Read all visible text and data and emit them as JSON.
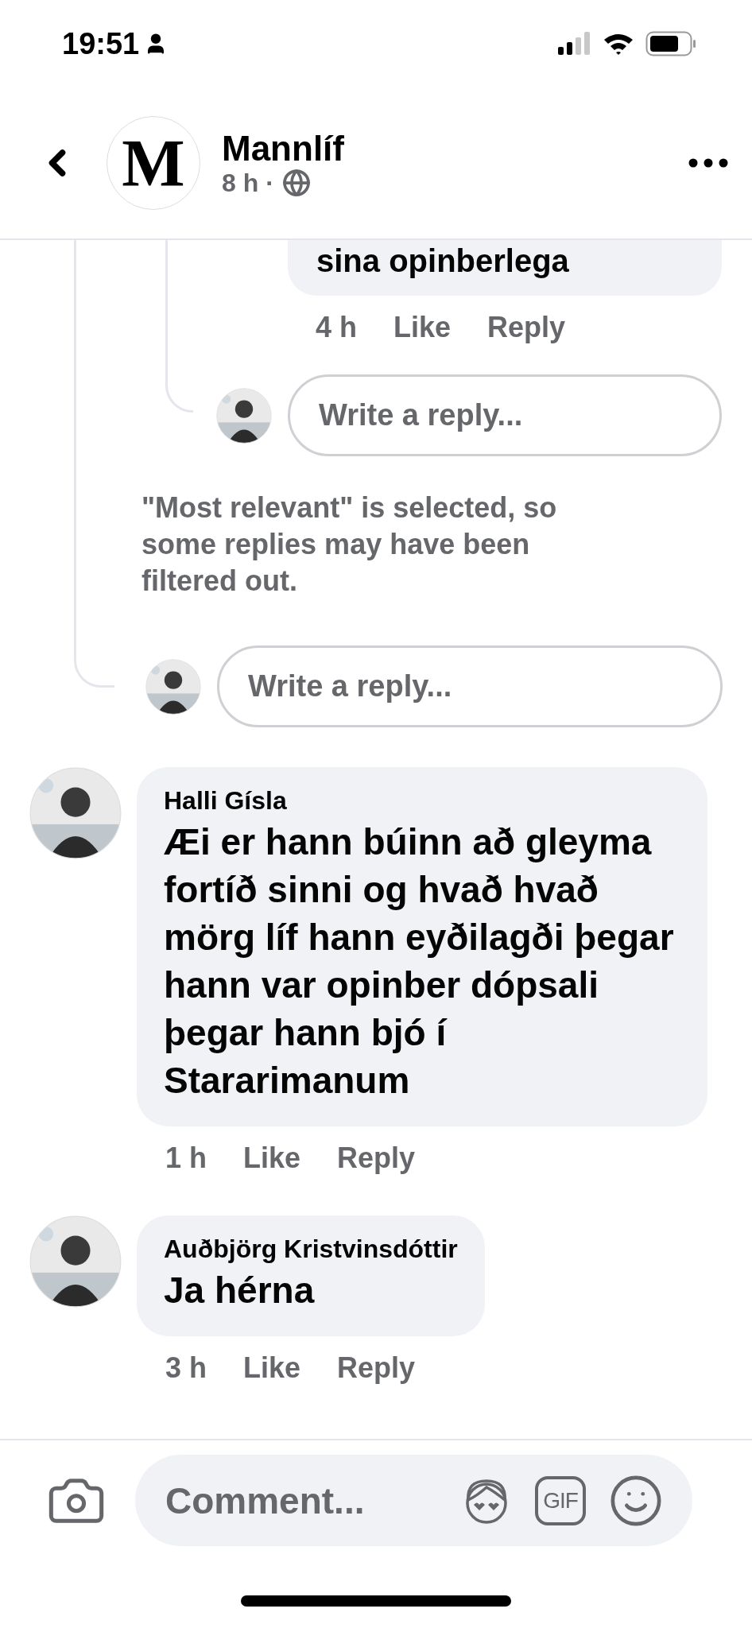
{
  "status_bar": {
    "time": "19:51"
  },
  "header": {
    "logo_letter": "M",
    "title": "Mannlíf",
    "meta": "8 h ·"
  },
  "thread": {
    "earlier_comment": {
      "text": "sina opinberlega",
      "time": "4 h",
      "actions": [
        "Like",
        "Reply"
      ]
    },
    "inner_reply_field": {
      "placeholder": "Write a reply..."
    },
    "filter_note": "\"Most relevant\" is selected, so some replies may have been filtered out.",
    "outer_reply_field": {
      "placeholder": "Write a reply..."
    }
  },
  "comments": [
    {
      "author": "Halli Gísla",
      "text": "Æi er hann búinn að gleyma fortíð sinni og hvað hvað mörg líf hann eyðilagði þegar hann var opinber dópsali þegar hann bjó í Stararimanum",
      "time": "1 h",
      "actions": [
        "Like",
        "Reply"
      ]
    },
    {
      "author": "Auðbjörg Kristvinsdóttir",
      "text": "Ja hérna",
      "time": "3 h",
      "actions": [
        "Like",
        "Reply"
      ]
    }
  ],
  "composer": {
    "placeholder": "Comment...",
    "gif_label": "GIF"
  }
}
